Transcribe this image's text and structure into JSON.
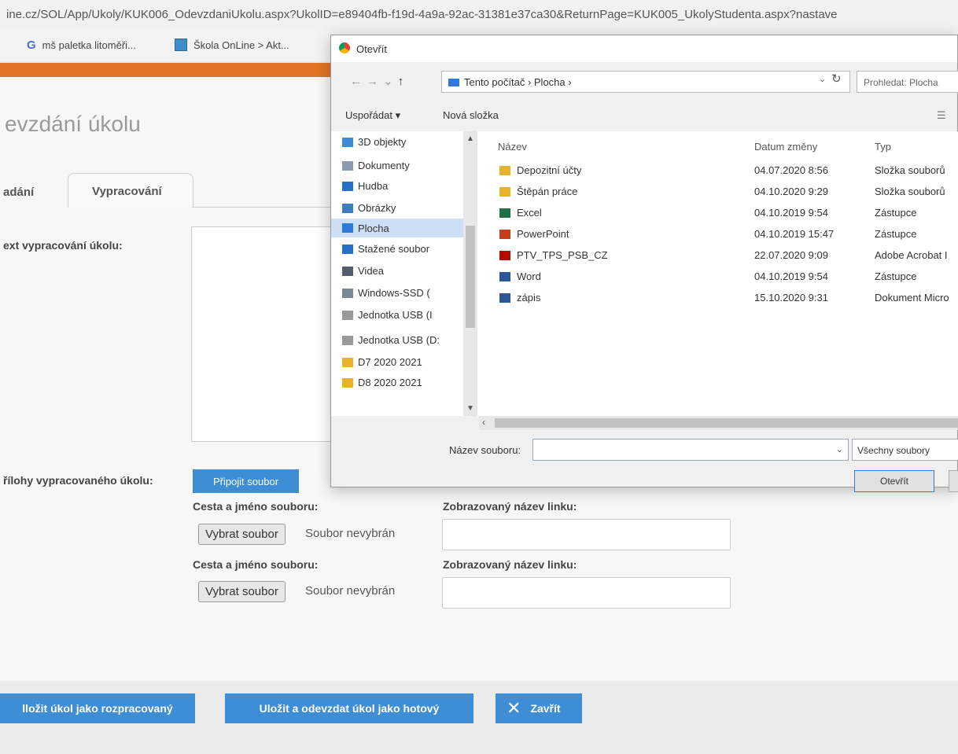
{
  "browser": {
    "url": "ine.cz/SOL/App/Ukoly/KUK006_OdevzdaniUkolu.aspx?UkolID=e89404fb-f19d-4a9a-92ac-31381e37ca30&ReturnPage=KUK005_UkolyStudenta.aspx?nastave",
    "bookmarks": [
      "mš paletka litoměři...",
      "Škola OnLine > Akt..."
    ]
  },
  "page": {
    "title": "evzdání úkolu",
    "tabs": [
      "adání",
      "Vypracování"
    ],
    "text_label": "ext vypracování úkolu:",
    "attachments_label": "řílohy vypracovaného úkolu:",
    "attach_button": "Připojit soubor",
    "file_rows": [
      {
        "path_label": "Cesta a jméno souboru:",
        "choose_button": "Vybrat soubor",
        "status": "Soubor nevybrán",
        "link_label": "Zobrazovaný název linku:"
      },
      {
        "path_label": "Cesta a jméno souboru:",
        "choose_button": "Vybrat soubor",
        "status": "Soubor nevybrán",
        "link_label": "Zobrazovaný název linku:"
      }
    ],
    "bottom_buttons": {
      "save_draft": "lložit úkol jako rozpracovaný",
      "save_submit": "Uložit a odevzdat úkol jako hotový",
      "close": "Zavřít"
    }
  },
  "dialog": {
    "title": "Otevřít",
    "breadcrumb": "Tento počítač  ›  Plocha  ›",
    "search_placeholder": "Prohledat: Plocha",
    "toolbar": {
      "organize": "Uspořádat ▾",
      "new_folder": "Nová složka"
    },
    "nav_items": [
      {
        "label": "3D objekty",
        "icon": "cube-icon",
        "color": "#3a8ad6"
      },
      {
        "label": "Dokumenty",
        "icon": "document-icon",
        "color": "#8a9bb0"
      },
      {
        "label": "Hudba",
        "icon": "music-icon",
        "color": "#2a6fc9"
      },
      {
        "label": "Obrázky",
        "icon": "pictures-icon",
        "color": "#3b7fc0"
      },
      {
        "label": "Plocha",
        "icon": "desktop-icon",
        "color": "#2f7ad8"
      },
      {
        "label": "Stažené soubor",
        "icon": "download-icon",
        "color": "#2a6fc9"
      },
      {
        "label": "Videa",
        "icon": "video-icon",
        "color": "#555e6b"
      },
      {
        "label": "Windows-SSD (",
        "icon": "drive-icon",
        "color": "#7a8797"
      },
      {
        "label": "Jednotka USB (I",
        "icon": "usb-drive-icon",
        "color": "#999999"
      },
      {
        "label": "Jednotka USB (D:",
        "icon": "usb-drive-icon",
        "color": "#999999"
      },
      {
        "label": "D7 2020 2021",
        "icon": "folder-icon",
        "color": "#e8b22a"
      },
      {
        "label": "D8 2020 2021",
        "icon": "folder-icon",
        "color": "#e8b22a"
      }
    ],
    "columns": {
      "name": "Název",
      "date": "Datum změny",
      "type": "Typ"
    },
    "files": [
      {
        "name": "Depozitní účty",
        "date": "04.07.2020 8:56",
        "type": "Složka souborů",
        "icon": "folder-icon",
        "color": "#e8b22a"
      },
      {
        "name": "Štěpán práce",
        "date": "04.10.2020 9:29",
        "type": "Složka souborů",
        "icon": "folder-icon",
        "color": "#e8b22a"
      },
      {
        "name": "Excel",
        "date": "04.10.2019 9:54",
        "type": "Zástupce",
        "icon": "excel-icon",
        "color": "#1e7145"
      },
      {
        "name": "PowerPoint",
        "date": "04.10.2019 15:47",
        "type": "Zástupce",
        "icon": "powerpoint-icon",
        "color": "#c43e1c"
      },
      {
        "name": "PTV_TPS_PSB_CZ",
        "date": "22.07.2020 9:09",
        "type": "Adobe Acrobat I",
        "icon": "pdf-icon",
        "color": "#b30b00"
      },
      {
        "name": "Word",
        "date": "04.10.2019 9:54",
        "type": "Zástupce",
        "icon": "word-icon",
        "color": "#2b579a"
      },
      {
        "name": "zápis",
        "date": "15.10.2020 9:31",
        "type": "Dokument Micro",
        "icon": "word-document-icon",
        "color": "#2b579a"
      }
    ],
    "filename_label": "Název souboru:",
    "filetype": "Všechny soubory",
    "open_button": "Otevřít"
  }
}
